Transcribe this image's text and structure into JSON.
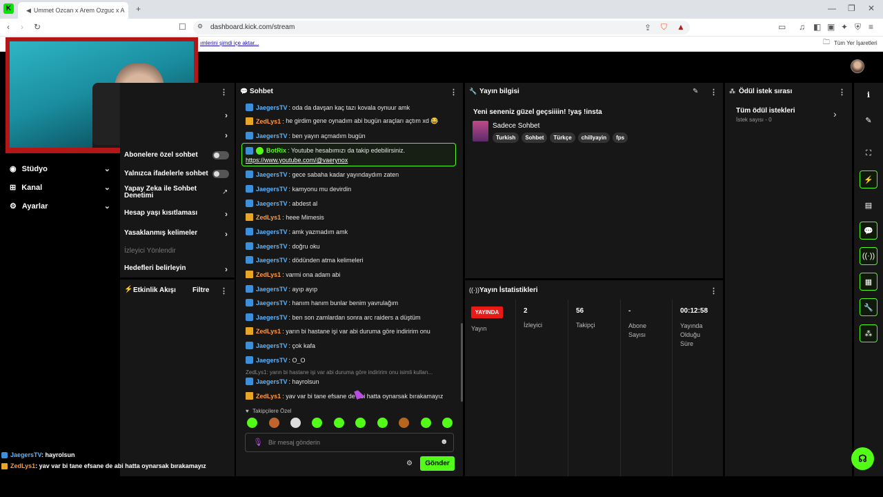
{
  "browser": {
    "tab_title": "Ummet Ozcan x Arem Ozguc x A",
    "url": "dashboard.kick.com/stream",
    "bookmarks_import": "ımlerini şimdi içe aktar...",
    "bookmarks_all": "Tüm Yer İşaretleri"
  },
  "sidebar": {
    "items": [
      {
        "label": "Stüdyo",
        "icon": "studio-icon"
      },
      {
        "label": "Kanal",
        "icon": "channel-icon"
      },
      {
        "label": "Ayarlar",
        "icon": "gear-icon"
      }
    ]
  },
  "chat_settings": {
    "subscribers_only": "Abonelere özel sohbet",
    "emotes_only": "Yalnızca ifadelerle sohbet",
    "ai_moderation": "Yapay Zeka ile Sohbet Denetimi",
    "account_age": "Hesap yaşı kısıtlaması",
    "banned_words": "Yasaklanmış kelimeler",
    "redirect_viewer": "İzleyici Yönlendir",
    "set_goals": "Hedefleri belirleyin"
  },
  "activity": {
    "title": "Etkinlik Akışı",
    "filter": "Filtre"
  },
  "chat": {
    "title": "Sohbet",
    "messages": [
      {
        "user": "JaegersTV",
        "type": "jaegers",
        "text": "oda da davşan kaç tazı kovala oynuur amk"
      },
      {
        "user": "ZedLys1",
        "type": "zed",
        "text": "he girdim gene oynadım abi bugün araçları açtım xd 😂"
      },
      {
        "user": "JaegersTV",
        "type": "jaegers",
        "text": "ben yayın açmadım bugün"
      },
      {
        "user": "JaegersTV",
        "type": "jaegers",
        "text": "gece sabaha kadar yayındaydım zaten"
      },
      {
        "user": "JaegersTV",
        "type": "jaegers",
        "text": "kamyonu mu devirdin"
      },
      {
        "user": "JaegersTV",
        "type": "jaegers",
        "text": "abdest al"
      },
      {
        "user": "ZedLys1",
        "type": "zed",
        "text": "heee Mimesis"
      },
      {
        "user": "JaegersTV",
        "type": "jaegers",
        "text": "amk yazmadım amk"
      },
      {
        "user": "JaegersTV",
        "type": "jaegers",
        "text": "doğru oku"
      },
      {
        "user": "JaegersTV",
        "type": "jaegers",
        "text": "dödünden atma kelimeleri"
      },
      {
        "user": "ZedLys1",
        "type": "zed",
        "text": "varmi ona adam abi"
      },
      {
        "user": "JaegersTV",
        "type": "jaegers",
        "text": "ayıp ayıp"
      },
      {
        "user": "JaegersTV",
        "type": "jaegers",
        "text": "hanım hanım bunlar benim yavrulağım"
      },
      {
        "user": "JaegersTV",
        "type": "jaegers",
        "text": "ben son zamlardan sonra arc raiders a düştüm"
      },
      {
        "user": "ZedLys1",
        "type": "zed",
        "text": "yarın bi hastane işi var abi duruma göre indiririm onu"
      },
      {
        "user": "JaegersTV",
        "type": "jaegers",
        "text": "çok kafa"
      },
      {
        "user": "JaegersTV",
        "type": "jaegers",
        "text": "O_O"
      },
      {
        "user": "JaegersTV",
        "type": "jaegers",
        "text": "hayrolsun"
      },
      {
        "user": "ZedLys1",
        "type": "zed",
        "text": "yav var bi tane efsane de abi hatta oynarsak bırakamayız"
      }
    ],
    "bot": {
      "user": "BotRix",
      "text": "Youtube hesabımızı da takip edebilirsiniz.",
      "link": "https://www.youtube.com/@vaerynox"
    },
    "reply_preview": "ZedLys1: yarın bi hastane işi var abi duruma göre indiririm onu isimli kullan...",
    "emote_section": "Takipçilere Özel",
    "input_placeholder": "Bir mesaj gönderin",
    "send": "Gönder"
  },
  "stream_info": {
    "title": "Yayın bilgisi",
    "stream_title": "Yeni seneniz güzel geçsiiiin! !yaş !insta",
    "category": "Sadece Sohbet",
    "tags": [
      "Turkish",
      "Sohbet",
      "Türkçe",
      "chillyayin",
      "fps"
    ]
  },
  "stats": {
    "title": "Yayın İstatistikleri",
    "live_badge": "YAYINDA",
    "stream_label": "Yayın",
    "viewers_value": "2",
    "viewers_label": "İzleyici",
    "followers_value": "56",
    "followers_label": "Takipçi",
    "subs_value": "-",
    "subs_label_1": "Abone",
    "subs_label_2": "Sayısı",
    "uptime_value": "00:12:58",
    "uptime_label_1": "Yayında",
    "uptime_label_2": "Olduğu",
    "uptime_label_3": "Süre"
  },
  "rewards": {
    "title": "Ödül istek sırası",
    "all_requests": "Tüm ödül istekleri",
    "count": "İstek sayısı - 0"
  },
  "overlay": {
    "line1_user": "JaegersTV",
    "line1_text": ": hayrolsun",
    "line2_user": "ZedLys1",
    "line2_text": ": yav var bi tane efsane de abi hatta oynarsak bırakamayız"
  },
  "colors": {
    "accent": "#53fc18",
    "live": "#e91916",
    "panel": "#171717"
  }
}
